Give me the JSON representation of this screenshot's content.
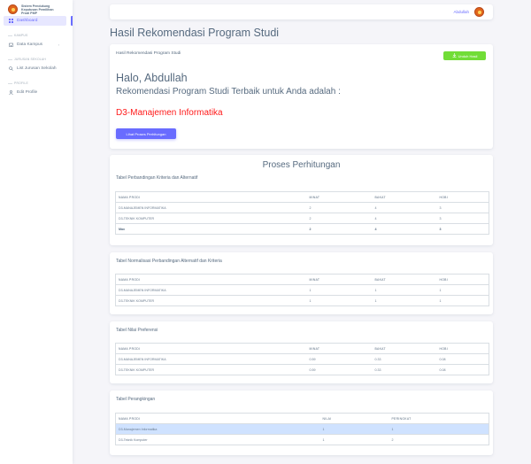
{
  "sidebar": {
    "brand": [
      "Sistem Pendukung",
      "Keputusan Pemilihan",
      "Prodi PMP"
    ],
    "dashboard": "Dashboard",
    "header_kampus": "KAMPUS",
    "data_kampus": "Data Kampus",
    "header_jurusan": "JURUSAN SEKOLAH",
    "list_jurusan": "List Jurusan Sekolah",
    "header_profile": "PROFILE",
    "edit_profile": "Edit Profile"
  },
  "navbar": {
    "user": "Abdullah"
  },
  "page_title": "Hasil Rekomendasi Program Studi",
  "result_card": {
    "title": "Hasil Rekomendasi Program Studi",
    "unduh": "Unduh Hasil",
    "greeting": "Halo, Abdullah",
    "subtitle": "Rekomendasi Program Studi Terbaik untuk Anda adalah :",
    "result": "D3-Manajemen Informatika",
    "lihat": "Lihat Proses Perhitungan"
  },
  "proses": {
    "title": "Proses Perhitungan",
    "t1": {
      "title": "Tabel Perbandingan Kriteria dan Alternatif",
      "headers": [
        "NAMA PRODI",
        "MINAT",
        "BAKAT",
        "HOBI"
      ],
      "rows": [
        [
          "D3-MANAJEMEN INFORMATIKA",
          "2",
          "4",
          "3"
        ],
        [
          "D3-TEKNIK KOMPUTER",
          "2",
          "4",
          "3"
        ],
        [
          "Max",
          "2",
          "4",
          "3"
        ]
      ]
    },
    "t2": {
      "title": "Tabel Normalisasi Perbandingan Alternatif dan Kriteria",
      "headers": [
        "NAMA PRODI",
        "MINAT",
        "BAKAT",
        "HOBI"
      ],
      "rows": [
        [
          "D3-MANAJEMEN INFORMATIKA",
          "1",
          "1",
          "1"
        ],
        [
          "D3-TEKNIK KOMPUTER",
          "1",
          "1",
          "1"
        ]
      ]
    },
    "t3": {
      "title": "Tabel Nilai Preferensi",
      "headers": [
        "NAMA PRODI",
        "MINAT",
        "BAKAT",
        "HOBI"
      ],
      "rows": [
        [
          "D3-MANAJEMEN INFORMATIKA",
          "0.59",
          "0.33",
          "0.08"
        ],
        [
          "D3-TEKNIK KOMPUTER",
          "0.59",
          "0.33",
          "0.08"
        ]
      ]
    },
    "t4": {
      "title": "Tabel Perangkingan",
      "headers": [
        "NAMA PRODI",
        "NILAI",
        "PERINGKAT"
      ],
      "rows": [
        [
          "D3-Manajemen Informatika",
          "1",
          "1"
        ],
        [
          "D3-Teknik Komputer",
          "1",
          "2"
        ]
      ]
    }
  },
  "colors": {
    "primary": "#696cff",
    "success": "#71dd37",
    "result": "#ff1a1a",
    "highlight": "#cfe2ff"
  }
}
